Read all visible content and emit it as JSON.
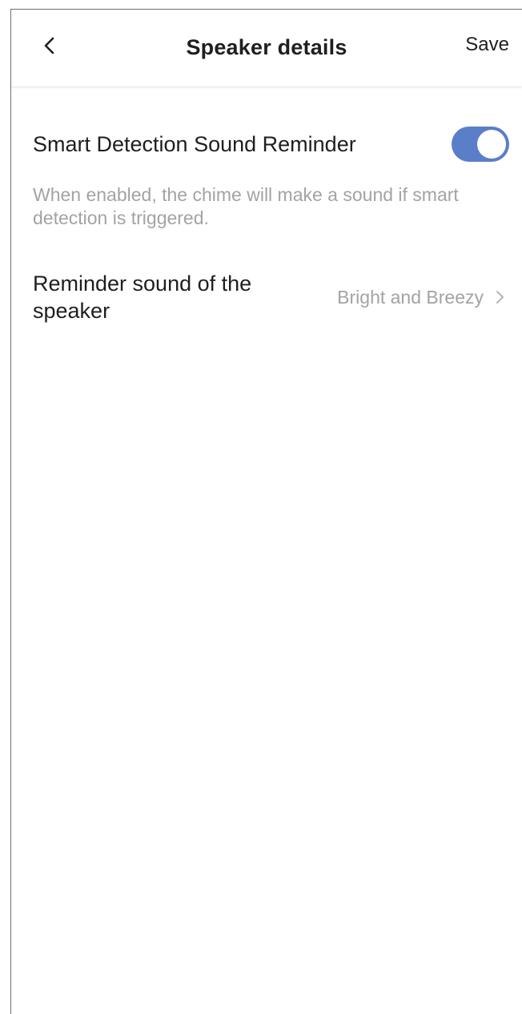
{
  "header": {
    "title": "Speaker details",
    "save_label": "Save",
    "back_icon": "chevron-left-icon"
  },
  "settings": {
    "smart_detection": {
      "label": "Smart Detection Sound Reminder",
      "enabled": true,
      "description": "When enabled, the chime will make a sound if smart detection is triggered."
    },
    "reminder_sound": {
      "label": "Reminder sound of the speaker",
      "value": "Bright and Breezy",
      "chevron_icon": "chevron-right-icon"
    }
  },
  "colors": {
    "toggle_on": "#5a7ec7",
    "secondary_text": "#a3a3a3",
    "primary_text": "#1f1f1f"
  }
}
